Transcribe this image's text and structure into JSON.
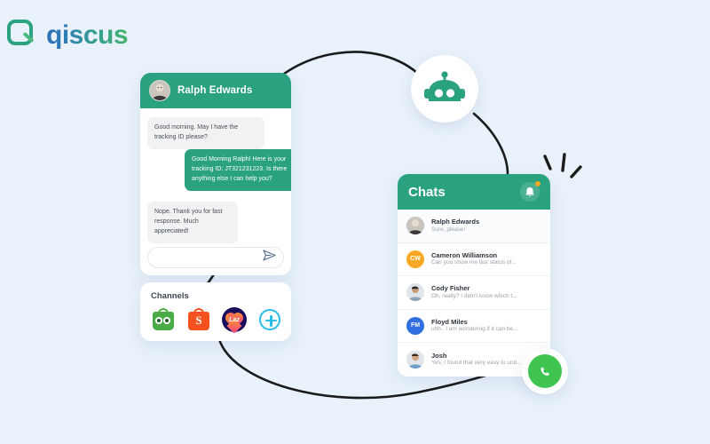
{
  "brand": {
    "name": "qiscus",
    "logo_icon": "speech-bubble-q-icon",
    "accent": "#2ba27f",
    "background": "#e9f2fb"
  },
  "conversation": {
    "contact_name": "Ralph Edwards",
    "avatar_icon": "user-photo-avatar",
    "messages": [
      {
        "side": "in",
        "text": "Good morning. May I have the tracking ID please?"
      },
      {
        "side": "out",
        "text": "Good Morning Ralph! Here is your tracking ID: JT321231223. Is there anything else I can help you?"
      },
      {
        "side": "in",
        "text": "Nope. Thank you for fast response. Much appreciated!"
      }
    ],
    "composer": {
      "placeholder": "",
      "value": "",
      "send_icon": "send-paper-plane-icon"
    }
  },
  "channels": {
    "title": "Channels",
    "items": [
      {
        "name": "Tokopedia",
        "icon": "tokopedia-icon"
      },
      {
        "name": "Shopee",
        "icon": "shopee-icon",
        "letter": "S"
      },
      {
        "name": "Lazada",
        "icon": "lazada-icon",
        "letter": "Laz"
      },
      {
        "name": "Add channel",
        "icon": "plus-circle-icon"
      }
    ]
  },
  "chats": {
    "title": "Chats",
    "bell_icon": "bell-notification-icon",
    "has_notification": true,
    "rows": [
      {
        "name": "Ralph Edwards",
        "preview": "Sure, please!",
        "avatar_type": "photo",
        "initials": "",
        "color": "#b9b4ae",
        "selected": true
      },
      {
        "name": "Cameron Williamson",
        "preview": "Can you show me last status of...",
        "avatar_type": "initials",
        "initials": "CW",
        "color": "#f9a826",
        "selected": false
      },
      {
        "name": "Cody Fisher",
        "preview": "Oh, really? I didn't know which t...",
        "avatar_type": "photo",
        "initials": "",
        "color": "#7f8c99",
        "selected": false
      },
      {
        "name": "Floyd Miles",
        "preview": "uhh.. I am wondering if it can be...",
        "avatar_type": "initials",
        "initials": "FM",
        "color": "#2f6fe0",
        "selected": false
      },
      {
        "name": "Josh",
        "preview": "Yes, I found that very easy to und...",
        "avatar_type": "photo",
        "initials": "",
        "color": "#8a6f5e",
        "selected": false
      }
    ]
  },
  "bot": {
    "icon": "robot-head-icon",
    "color": "#2ba27f"
  },
  "whatsapp": {
    "icon": "whatsapp-icon",
    "color": "#3fc450"
  },
  "decor": {
    "sparks_icon": "spark-lines-icon",
    "connector_icon": "curved-connector-line"
  }
}
